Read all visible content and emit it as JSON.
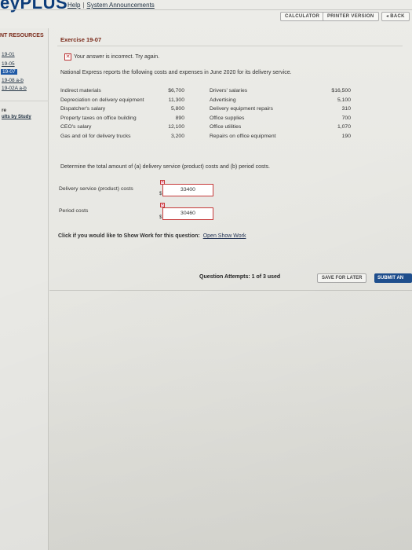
{
  "header": {
    "logo_text": "eyPLUS",
    "links": [
      "Help",
      "System Announcements"
    ],
    "buttons": {
      "calculator": "CALCULATOR",
      "printer": "PRINTER VERSION",
      "back": "◂ BACK"
    }
  },
  "sidebar": {
    "title": "NT RESOURCES",
    "items": [
      {
        "label": "19-01",
        "active": false
      },
      {
        "label": "19-05",
        "active": false
      },
      {
        "label": "19-07",
        "active": true
      },
      {
        "label": "19-08 a-b",
        "active": false
      },
      {
        "label": "19-02A a-b",
        "active": false
      }
    ],
    "extra_a": "re",
    "extra_b": "ults by Study"
  },
  "exercise": {
    "title": "Exercise 19-07",
    "feedback": "Your answer is incorrect.  Try again.",
    "intro": "National Express reports the following costs and expenses in June 2020 for its delivery service.",
    "rows": [
      {
        "item1": "Indirect materials",
        "amt1": "$6,700",
        "item2": "Drivers' salaries",
        "amt2": "$16,500"
      },
      {
        "item1": "Depreciation on delivery equipment",
        "amt1": "11,300",
        "item2": "Advertising",
        "amt2": "5,100"
      },
      {
        "item1": "Dispatcher's salary",
        "amt1": "5,800",
        "item2": "Delivery equipment repairs",
        "amt2": "310"
      },
      {
        "item1": "Property taxes on office building",
        "amt1": "890",
        "item2": "Office supplies",
        "amt2": "700"
      },
      {
        "item1": "CEO's salary",
        "amt1": "12,100",
        "item2": "Office utilities",
        "amt2": "1,070"
      },
      {
        "item1": "Gas and oil for delivery trucks",
        "amt1": "3,200",
        "item2": "Repairs on office equipment",
        "amt2": "190"
      }
    ],
    "question": "Determine the total amount of (a) delivery service (product) costs and (b) period costs.",
    "answers": [
      {
        "label": "Delivery service (product) costs",
        "value": "33400",
        "currency": "$"
      },
      {
        "label": "Period costs",
        "value": "30460",
        "currency": "$"
      }
    ],
    "show_work_prompt": "Click if you would like to Show Work for this question:",
    "show_work_link": "Open Show Work"
  },
  "footer": {
    "attempts": "Question Attempts: 1 of 3 used",
    "save_label": "SAVE FOR LATER",
    "submit_label": "SUBMIT AN"
  },
  "colors": {
    "brand": "#0d3d7a",
    "section_title": "#7a2a1a",
    "error": "#c63b3b",
    "submit": "#1f4f8f"
  }
}
